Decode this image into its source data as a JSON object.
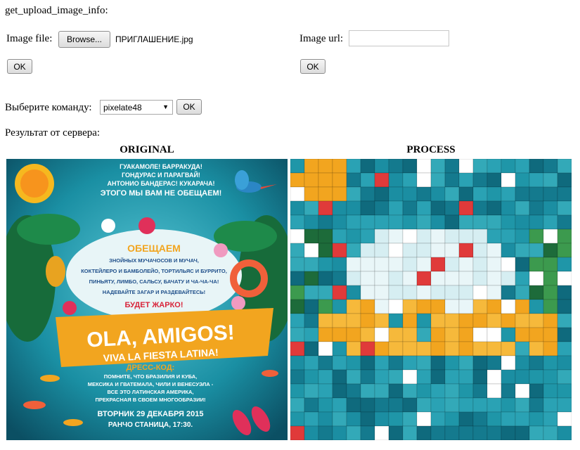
{
  "page": {
    "heading": "get_upload_image_info:",
    "image_file_label": "Image file:",
    "browse_label": "Browse...",
    "file_name": "ПРИГЛАШЕНИЕ.jpg",
    "ok_label": "OK",
    "image_url_label": "Image url:",
    "image_url_value": "",
    "command_label": "Выберите команду:",
    "command_selected": "pixelate48",
    "result_label": "Результат от сервера:",
    "original_caption": "ORIGINAL",
    "process_caption": "PROCESS"
  },
  "poster": {
    "top_lines": [
      "ГУАКАМОЛЕ! БАРРАКУДА!",
      "ГОНДУРАС И ПАРАГВАЙ!",
      "АНТОНИО БАНДЕРАС! КУКАРАЧА!"
    ],
    "promise_line": "ЭТОГО МЫ ВАМ НЕ ОБЕЩАЕМ!",
    "promise_title": "ОБЕЩАЕМ",
    "promise_lines": [
      "ЗНОЙНЫХ МУЧАЧОСОВ И МУЧАЧ,",
      "КОКТЕЙЛЕРО И БАМБОЛЕЙО, ТОРТИЛЬЯС И БУРРИТО,",
      "ПИНЬЯТУ, ЛИМБО, САЛЬСУ, БАЧАТУ И ЧА-ЧА-ЧА!",
      "НАДЕВАЙТЕ ЗАГАР И РАЗДЕВАЙТЕСЬ!"
    ],
    "hot_line": "БУДЕТ ЖАРКО!",
    "banner_main": "OLA, AMIGOS!",
    "banner_sub": "VIVA LA FIESTA LATINA!",
    "dress_title": "ДРЕСС-КОД:",
    "dress_lines": [
      "ПОМНИТЕ, ЧТО БРАЗИЛИЯ И КУБА,",
      "МЕКСИКА И ГВАТЕМАЛА, ЧИЛИ И ВЕНЕСУЭЛА -",
      "ВСЕ ЭТО ЛАТИНСКАЯ АМЕРИКА,",
      "ПРЕКРАСНАЯ В СВОЕМ МНОГООБРАЗИИ!"
    ],
    "date_line": "ВТОРНИК 29 ДЕКАБРЯ 2015",
    "place_line": "РАНЧО СТАНИЦА, 17:30."
  },
  "colors": {
    "sea": "#1a8fa3",
    "sea_dark": "#0d5e70",
    "banner": "#f2a51f",
    "hot_red": "#d8243a",
    "promise_text": "#1f4f8a"
  }
}
